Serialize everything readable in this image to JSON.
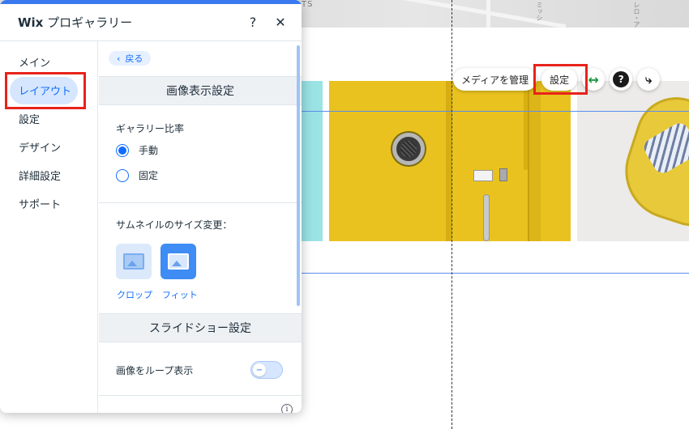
{
  "canvas": {
    "map_labels": [
      "TS",
      "ミッシ",
      "レロ・ア"
    ],
    "toolbar": {
      "manage_media_label": "メディアを管理",
      "settings_label": "設定",
      "stretch_icon": "↔",
      "help_icon": "?",
      "animation_icon": "⤷"
    },
    "colors": {
      "guide_line": "#5b8def",
      "highlight": "#e8231b",
      "stretch_icon": "#1a9b3c"
    }
  },
  "panel": {
    "title_bold": "Wix",
    "title_rest": " プロギャラリー",
    "help_glyph": "?",
    "close_glyph": "✕",
    "nav": [
      {
        "label": "メイン"
      },
      {
        "label": "レイアウト",
        "active": true
      },
      {
        "label": "設定"
      },
      {
        "label": "デザイン"
      },
      {
        "label": "詳細設定"
      },
      {
        "label": "サポート"
      }
    ],
    "back_label": "戻る",
    "back_glyph": "‹",
    "image_display_section": "画像表示設定",
    "gallery_ratio_label": "ギャラリー比率",
    "ratio_options": [
      {
        "label": "手動",
        "selected": true
      },
      {
        "label": "固定",
        "selected": false
      }
    ],
    "thumbnail_resize_label": "サムネイルのサイズ変更：",
    "thumbnail_options": [
      {
        "label": "クロップ",
        "selected": false
      },
      {
        "label": "フィット",
        "selected": true
      }
    ],
    "slideshow_section": "スライドショー設定",
    "loop_label": "画像をループ表示",
    "loop_toggle_on": false,
    "toggle_glyph": "−",
    "info_glyph": "i",
    "colors": {
      "accent": "#116dff",
      "topbar": "#3a78ef",
      "active_nav_bg": "#d6e6fe",
      "section_bg": "#eef1f4"
    }
  }
}
